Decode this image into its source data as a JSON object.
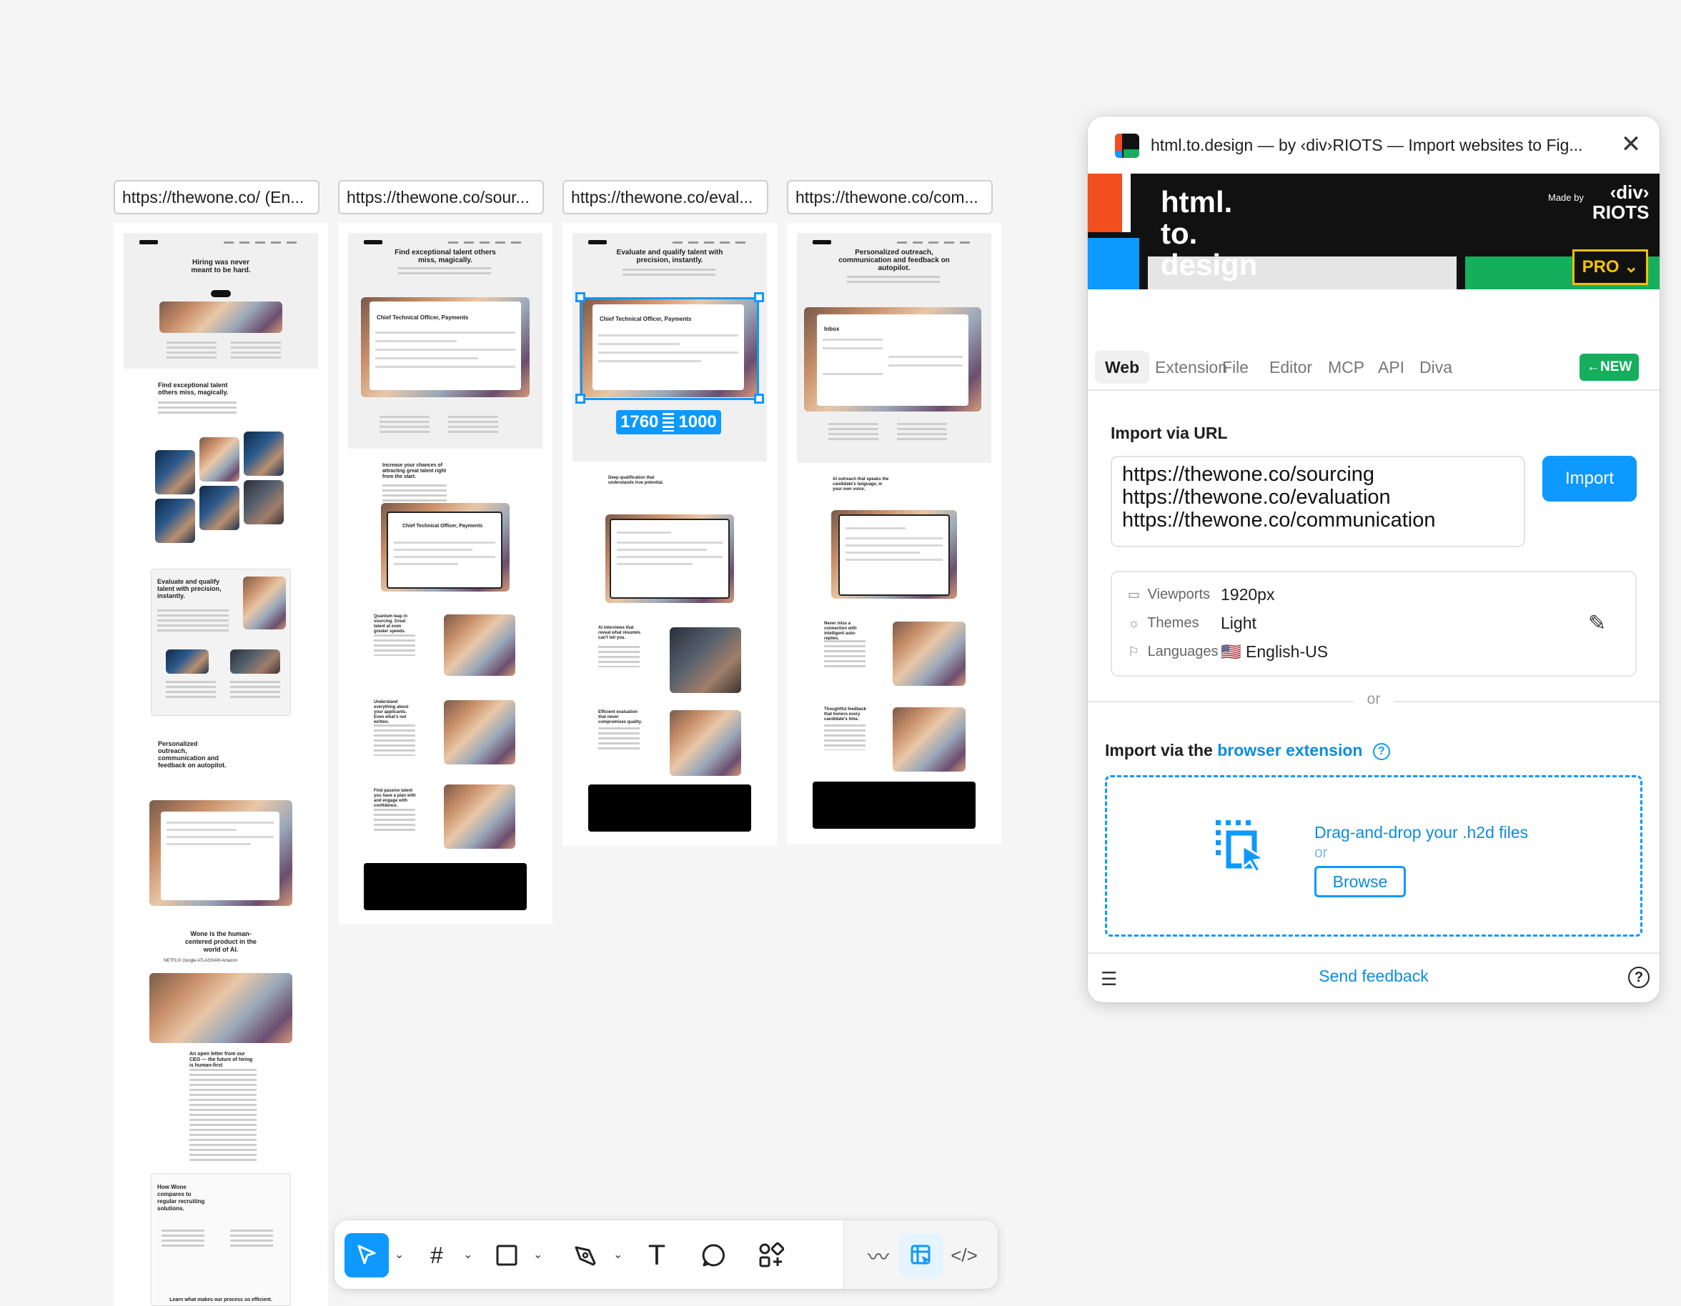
{
  "canvas": {
    "frame_labels": [
      "https://thewone.co/ (En...",
      "https://thewone.co/sour...",
      "https://thewone.co/eval...",
      "https://thewone.co/com..."
    ],
    "frame1": {
      "hero_title": "Hiring was never meant to be hard.",
      "s1": "Find exceptional talent others miss, magically.",
      "s2": "Evaluate and qualify talent with precision, instantly.",
      "s3": "Personalized outreach, communication and feedback on autopilot.",
      "s4": "Wone is the human-centered product in the world of AI.",
      "s5": "An open letter from our CEO — the future of hiring is human-first",
      "s6": "How Wone compares to regular recruiting solutions.",
      "logos": "NETFLIX   Google   ATLASSIAN   Amazon",
      "bottom": "Learn what makes our process so efficient."
    },
    "frame2": {
      "hero_title": "Find exceptional talent others miss, magically.",
      "shot_title": "Chief Technical Officer, Payments",
      "s1": "Increase your chances of attracting great talent right from the start.",
      "s2": "Quantum leap in sourcing. Great talent at even greater speeds.",
      "s3": "Understand everything about your applicants. Even what's not written.",
      "s4": "Find passive talent you have a plan with and engage with confidence."
    },
    "frame3": {
      "hero_title": "Evaluate and qualify talent with precision, instantly.",
      "shot_title": "Chief Technical Officer, Payments",
      "s1": "Deep qualification that understands true potential.",
      "s2": "AI interviews that reveal what résumés can't tell you.",
      "s3": "Efficient evaluation that never compromises quality."
    },
    "frame4": {
      "hero_title": "Personalized outreach, communication and feedback on autopilot.",
      "shot_title": "Inbox",
      "s1": "AI outreach that speaks the candidate's language, in your own voice.",
      "s2": "Never miss a connection with intelligent auto-replies.",
      "s3": "Thoughtful feedback that honors every candidate's time."
    },
    "selection": {
      "width": "1760",
      "height": "1000"
    }
  },
  "plugin": {
    "title": "html.to.design — by ‹div›RIOTS — Import websites to Fig...",
    "banner": {
      "wordmark": [
        "html.",
        "to.",
        "design"
      ],
      "made_by": "Made by",
      "brand": "‹div›\nRIOTS",
      "plan": "PRO"
    },
    "tabs": [
      "Web",
      "Extension",
      "File",
      "Editor",
      "MCP",
      "API",
      "Diva"
    ],
    "new_badge": "←NEW",
    "import_url_label": "Import via URL",
    "urls": [
      "https://thewone.co/sourcing",
      "https://thewone.co/evaluation",
      "https://thewone.co/communication"
    ],
    "import_button": "Import",
    "settings": [
      {
        "label": "Viewports",
        "value": "1920px",
        "icon": "monitor-icon"
      },
      {
        "label": "Themes",
        "value": "Light",
        "icon": "sun-icon"
      },
      {
        "label": "Languages",
        "value": "🇺🇸 English-US",
        "icon": "flag-icon"
      }
    ],
    "or": "or",
    "extension_label_prefix": "Import via the",
    "extension_link": "browser extension",
    "drop_text": "Drag-and-drop your .h2d files",
    "drop_or": "or",
    "browse_button": "Browse",
    "feedback": "Send feedback"
  },
  "toolbar": {
    "tools": [
      "move-tool",
      "frame-tool",
      "shape-tool",
      "pen-tool",
      "text-tool",
      "comment-tool",
      "actions-tool"
    ],
    "right_tools": [
      "draw-mode",
      "design-mode",
      "dev-mode"
    ]
  },
  "colors": {
    "accent": "#0d99ff",
    "green": "#14ae5c",
    "orange": "#f24e1e",
    "pro": "#f2c200"
  }
}
